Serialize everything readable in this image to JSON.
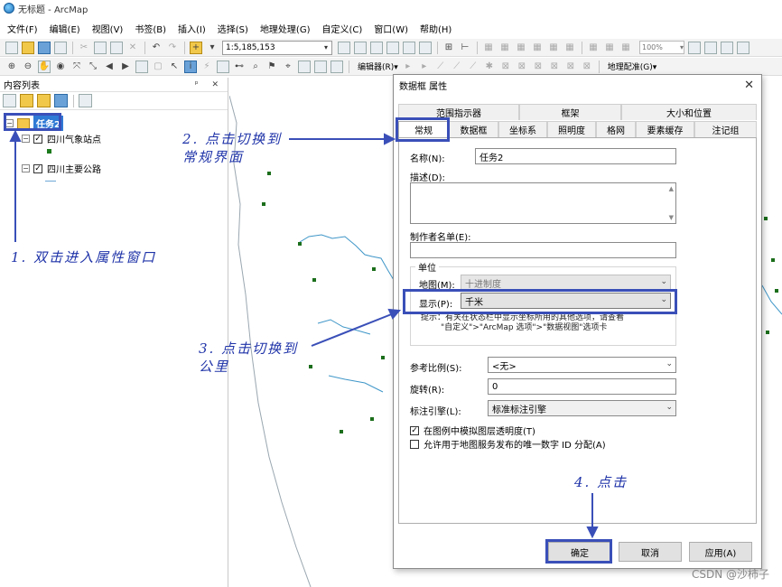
{
  "window": {
    "title": "无标题 - ArcMap"
  },
  "menu": [
    "文件(F)",
    "编辑(E)",
    "视图(V)",
    "书签(B)",
    "插入(I)",
    "选择(S)",
    "地理处理(G)",
    "自定义(C)",
    "窗口(W)",
    "帮助(H)"
  ],
  "toolbar": {
    "scale": "1:5,185,153",
    "zoom": "100%",
    "editor_label": "编辑器(R)▾",
    "georef_label": "地理配准(G)▾"
  },
  "toc": {
    "title": "内容列表",
    "controls": "ᵖ ✕",
    "frame_name": "任务2",
    "layers": [
      {
        "name": "四川气象站点"
      },
      {
        "name": "四川主要公路"
      }
    ]
  },
  "dialog": {
    "title": "数据框 属性",
    "tabs_row1": [
      "范围指示器",
      "框架",
      "大小和位置"
    ],
    "tabs_row2": [
      "常规",
      "数据框",
      "坐标系",
      "照明度",
      "格网",
      "要素缓存",
      "注记组"
    ],
    "name_label": "名称(N):",
    "name_value": "任务2",
    "desc_label": "描述(D):",
    "credits_label": "制作者名单(E):",
    "units_group": "单位",
    "map_units_label": "地图(M):",
    "map_units_value": "十进制度",
    "display_units_label": "显示(P):",
    "display_units_value": "千米",
    "hint_line1": "提示：有关在状态栏中显示坐标所用的其他选项，请查看",
    "hint_line2": "\"自定义\">\"ArcMap 选项\">\"数据视图\"选项卡",
    "ref_scale_label": "参考比例(S):",
    "ref_scale_value": "<无>",
    "rotation_label": "旋转(R):",
    "rotation_value": "0",
    "label_engine_label": "标注引擎(L):",
    "label_engine_value": "标准标注引擎",
    "check1": "在图例中模拟图层透明度(T)",
    "check2": "允许用于地图服务发布的唯一数字 ID 分配(A)",
    "ok": "确定",
    "cancel": "取消",
    "apply": "应用(A)"
  },
  "annotations": {
    "step1": "1. 双击进入属性窗口",
    "step2_line1": "2. 点击切换到",
    "step2_line2": "常规界面",
    "step3_line1": "3. 点击切换到",
    "step3_line2": "公里",
    "step4": "4. 点击"
  },
  "watermark": "CSDN @沙柿子"
}
